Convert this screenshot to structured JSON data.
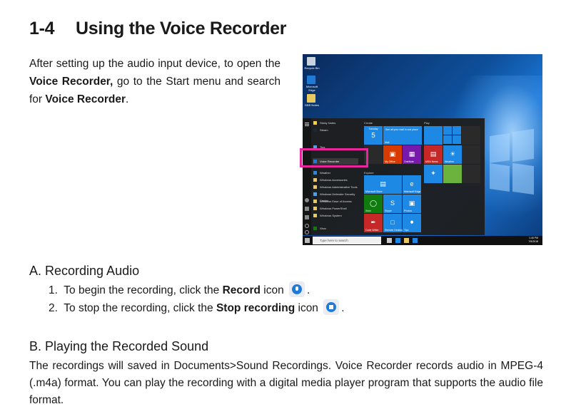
{
  "heading": {
    "number": "1-4",
    "title": "Using the Voice Recorder"
  },
  "intro": {
    "t1": "After setting up the audio input device, to open the ",
    "b1": "Voice Recorder,",
    "t2": " go to the Start menu and search for ",
    "b2": "Voice Recorder",
    "t3": "."
  },
  "screenshot": {
    "desktop_icons": [
      "Recycle Bin",
      "Microsoft Edge",
      "DBS Notes"
    ],
    "start_list": [
      "Sticky Notes",
      "Steam",
      "Tips",
      "Voice Recorder",
      "Weather",
      "Windows Accessories",
      "Windows Administrative Tools",
      "Windows Defender Security Center",
      "Windows Ease of Access",
      "Windows PowerShell",
      "Windows System",
      "Xbox"
    ],
    "group_create": "Create",
    "group_play": "Play",
    "group_explore": "Explore",
    "tiles": {
      "calendar_day": "Tuesday",
      "calendar_date": "5",
      "calendar_event": "See all your mail in one place",
      "mail": "Mail",
      "my_office": "My Office",
      "onenote": "OneNote",
      "msn_news": "MSN News",
      "weather": "Weather",
      "store": "Microsoft Store",
      "edge": "Microsoft Edge",
      "xbox": "Xbox",
      "skype": "Skype",
      "photos": "Photos",
      "code_writer": "Code Writer",
      "remote_desktop": "Remote Desktop",
      "tips": "Tips"
    },
    "search_placeholder": "Type here to search",
    "clock_time": "1:46 PM",
    "clock_date": "7/5/2018"
  },
  "section_a": {
    "title": "A. Recording Audio",
    "step1": {
      "num": "1.",
      "pre": "To begin the recording, click the ",
      "bold": "Record",
      "post": " icon",
      "end": "."
    },
    "step2": {
      "num": "2.",
      "pre": "To stop the recording, click the ",
      "bold": "Stop recording",
      "post": " icon",
      "end": "."
    }
  },
  "section_b": {
    "title": "B. Playing the Recorded Sound",
    "body": "The recordings will saved in Documents>Sound Recordings. Voice Recorder records audio in MPEG-4 (.m4a) format. You can play the recording with a digital media player program that supports the audio file format."
  },
  "colors": {
    "highlight": "#e8259a",
    "accent": "#1e7ad6"
  }
}
